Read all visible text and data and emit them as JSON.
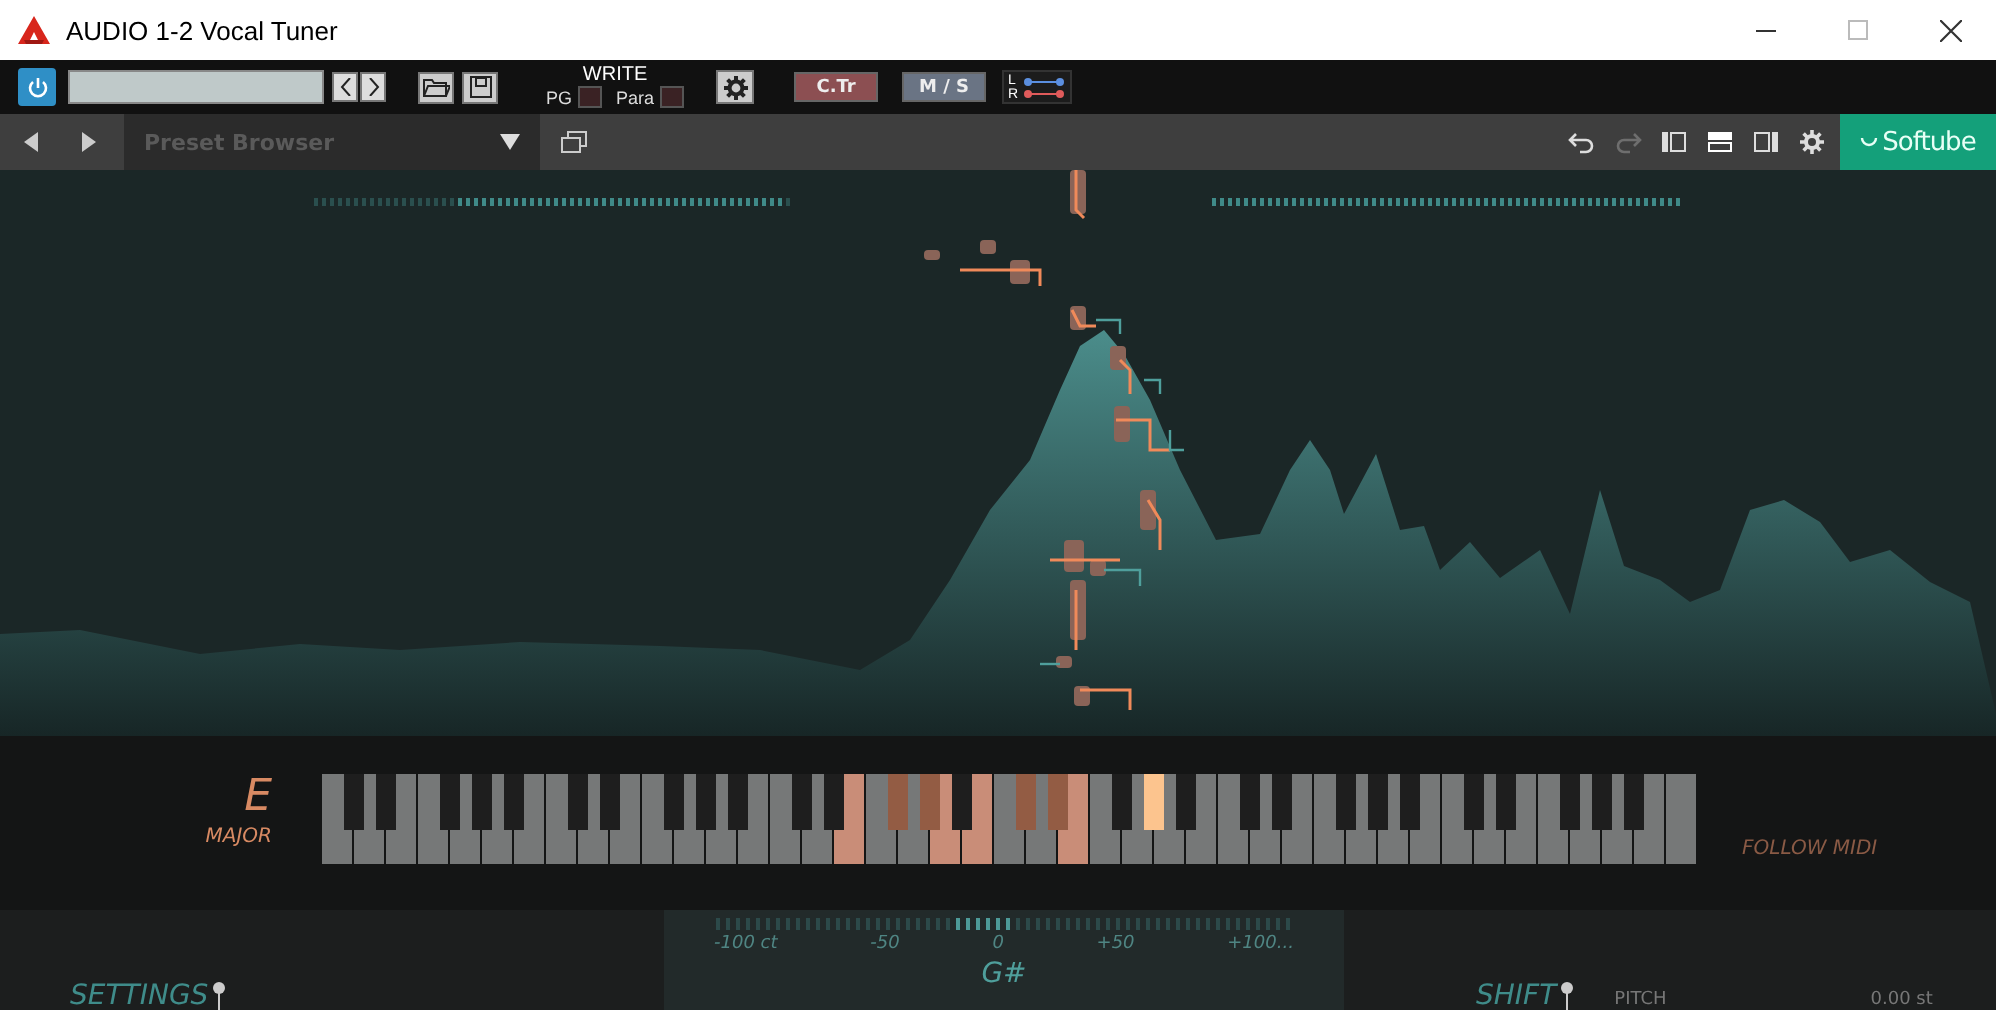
{
  "window": {
    "title": "AUDIO 1-2 Vocal Tuner"
  },
  "host_toolbar": {
    "power_on": true,
    "write_label": "WRITE",
    "pg_label": "PG",
    "pg_on": false,
    "para_label": "Para",
    "para_on": false,
    "ctr_label": "C.Tr",
    "ms_label": "M / S",
    "l_label": "L",
    "r_label": "R"
  },
  "plugin_bar": {
    "preset_placeholder": "Preset Browser",
    "redo_disabled": true,
    "brand": "Softube"
  },
  "key": {
    "root": "E",
    "scale": "MAJOR",
    "follow_midi": "FOLLOW MIDI"
  },
  "keyboard": {
    "white_keys": [
      {
        "in_scale": false
      },
      {
        "in_scale": false
      },
      {
        "in_scale": false
      },
      {
        "in_scale": false
      },
      {
        "in_scale": false
      },
      {
        "in_scale": false
      },
      {
        "in_scale": false
      },
      {
        "in_scale": false
      },
      {
        "in_scale": false
      },
      {
        "in_scale": false
      },
      {
        "in_scale": false
      },
      {
        "in_scale": false
      },
      {
        "in_scale": false
      },
      {
        "in_scale": false
      },
      {
        "in_scale": false
      },
      {
        "in_scale": false
      },
      {
        "in_scale": true
      },
      {
        "in_scale": false
      },
      {
        "in_scale": false
      },
      {
        "in_scale": true
      },
      {
        "in_scale": true
      },
      {
        "in_scale": false
      },
      {
        "in_scale": false
      },
      {
        "in_scale": true
      },
      {
        "in_scale": false
      },
      {
        "in_scale": false
      },
      {
        "in_scale": false
      },
      {
        "in_scale": false
      },
      {
        "in_scale": false
      },
      {
        "in_scale": false
      },
      {
        "in_scale": false
      },
      {
        "in_scale": false
      },
      {
        "in_scale": false
      },
      {
        "in_scale": false
      },
      {
        "in_scale": false
      },
      {
        "in_scale": false
      },
      {
        "in_scale": false
      },
      {
        "in_scale": false
      },
      {
        "in_scale": false
      },
      {
        "in_scale": false
      },
      {
        "in_scale": false
      },
      {
        "in_scale": false
      },
      {
        "in_scale": false
      }
    ],
    "black_keys": [
      {
        "in_scale": false,
        "detected": false
      },
      {
        "in_scale": false,
        "detected": false
      },
      {
        "in_scale": false,
        "detected": false
      },
      {
        "in_scale": false,
        "detected": false
      },
      {
        "in_scale": false,
        "detected": false
      },
      {
        "in_scale": false,
        "detected": false
      },
      {
        "in_scale": false,
        "detected": false
      },
      {
        "in_scale": false,
        "detected": false
      },
      {
        "in_scale": false,
        "detected": false
      },
      {
        "in_scale": false,
        "detected": false
      },
      {
        "in_scale": false,
        "detected": false
      },
      {
        "in_scale": false,
        "detected": false
      },
      {
        "in_scale": true,
        "detected": false
      },
      {
        "in_scale": true,
        "detected": false
      },
      {
        "in_scale": false,
        "detected": false
      },
      {
        "in_scale": true,
        "detected": false
      },
      {
        "in_scale": true,
        "detected": false
      },
      {
        "in_scale": false,
        "detected": false
      },
      {
        "in_scale": true,
        "detected": true
      },
      {
        "in_scale": false,
        "detected": false
      },
      {
        "in_scale": false,
        "detected": false
      },
      {
        "in_scale": false,
        "detected": false
      },
      {
        "in_scale": false,
        "detected": false
      },
      {
        "in_scale": false,
        "detected": false
      },
      {
        "in_scale": false,
        "detected": false
      },
      {
        "in_scale": false,
        "detected": false
      },
      {
        "in_scale": false,
        "detected": false
      },
      {
        "in_scale": false,
        "detected": false
      },
      {
        "in_scale": false,
        "detected": false
      },
      {
        "in_scale": false,
        "detected": false
      }
    ]
  },
  "meter": {
    "ticks": [
      "-100 ct",
      "-50",
      "0",
      "+50",
      "+100..."
    ],
    "note": "G#"
  },
  "settings": {
    "label": "SETTINGS"
  },
  "shift": {
    "label": "SHIFT",
    "param": "PITCH",
    "value": "0.00 st"
  }
}
